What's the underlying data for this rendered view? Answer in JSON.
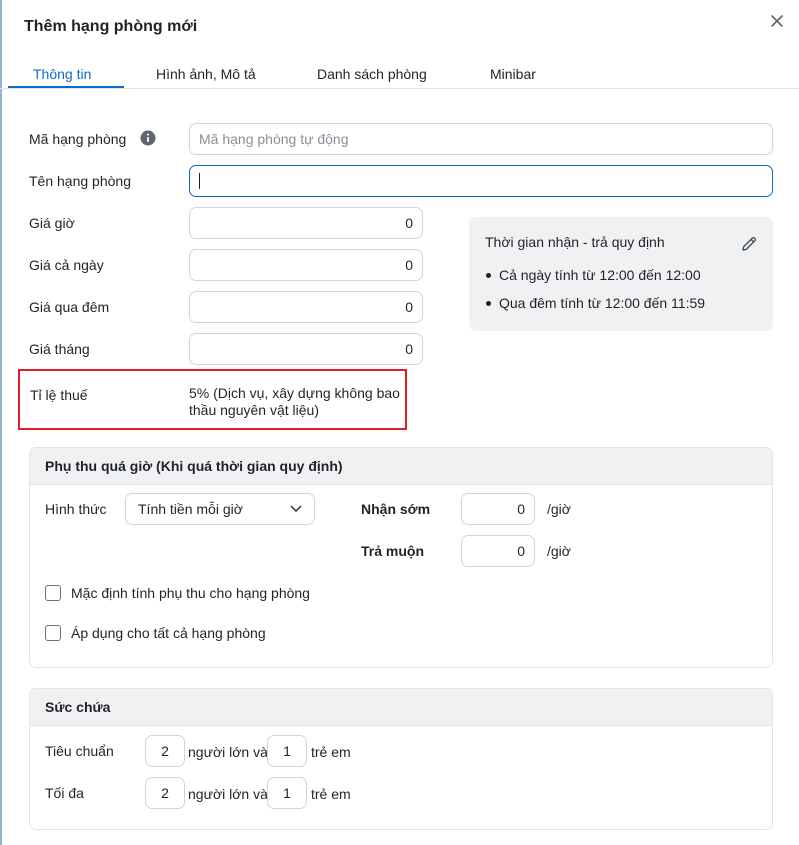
{
  "dialog": {
    "title": "Thêm hạng phòng mới",
    "close_symbol": "✕"
  },
  "tabs": [
    {
      "label": "Thông tin",
      "active": true
    },
    {
      "label": "Hình ảnh, Mô tả",
      "active": false
    },
    {
      "label": "Danh sách phòng",
      "active": false
    },
    {
      "label": "Minibar",
      "active": false
    }
  ],
  "form": {
    "room_code": {
      "label": "Mã hạng phòng",
      "placeholder": "Mã hạng phòng tự động",
      "icon": "info-icon"
    },
    "room_name": {
      "label": "Tên hạng phòng",
      "value": ""
    },
    "hourly_price": {
      "label": "Giá giờ",
      "value": "0"
    },
    "daily_price": {
      "label": "Giá cả ngày",
      "value": "0"
    },
    "overnight_price": {
      "label": "Giá qua đêm",
      "value": "0"
    },
    "monthly_price": {
      "label": "Giá tháng",
      "value": "0"
    },
    "tax_rate": {
      "label": "Tỉ lệ thuế",
      "value": "5% (Dịch vụ, xây dựng không bao thầu nguyên vật liệu)"
    }
  },
  "checkin": {
    "title": "Thời gian nhận - trả quy định",
    "edit_icon": "pencil-icon",
    "rules": [
      "Cả ngày tính từ 12:00 đến 12:00",
      "Qua đêm tính từ 12:00 đến 11:59"
    ]
  },
  "surcharge": {
    "title": "Phụ thu quá giờ (Khi quá thời gian quy định)",
    "method_label": "Hình thức",
    "method_value": "Tính tiền mỗi giờ",
    "early_label": "Nhận sớm",
    "early_value": "0",
    "late_label": "Trả muộn",
    "late_value": "0",
    "unit": "/giờ",
    "default_checkbox": {
      "label": "Mặc định tính phụ thu cho hạng phòng",
      "checked": false
    },
    "apply_all_checkbox": {
      "label": "Áp dụng cho tất cả hạng phòng",
      "checked": false
    }
  },
  "capacity": {
    "title": "Sức chứa",
    "standard": {
      "label": "Tiêu chuẩn",
      "adults": "2",
      "children": "1"
    },
    "maximum": {
      "label": "Tối đa",
      "adults": "2",
      "children": "1"
    },
    "adults_text": "người lớn và",
    "children_text": "trẻ em"
  },
  "colors": {
    "accent": "#0b6bcb",
    "highlight_border": "#e01e26",
    "panel_bg": "#f0f1f3"
  }
}
